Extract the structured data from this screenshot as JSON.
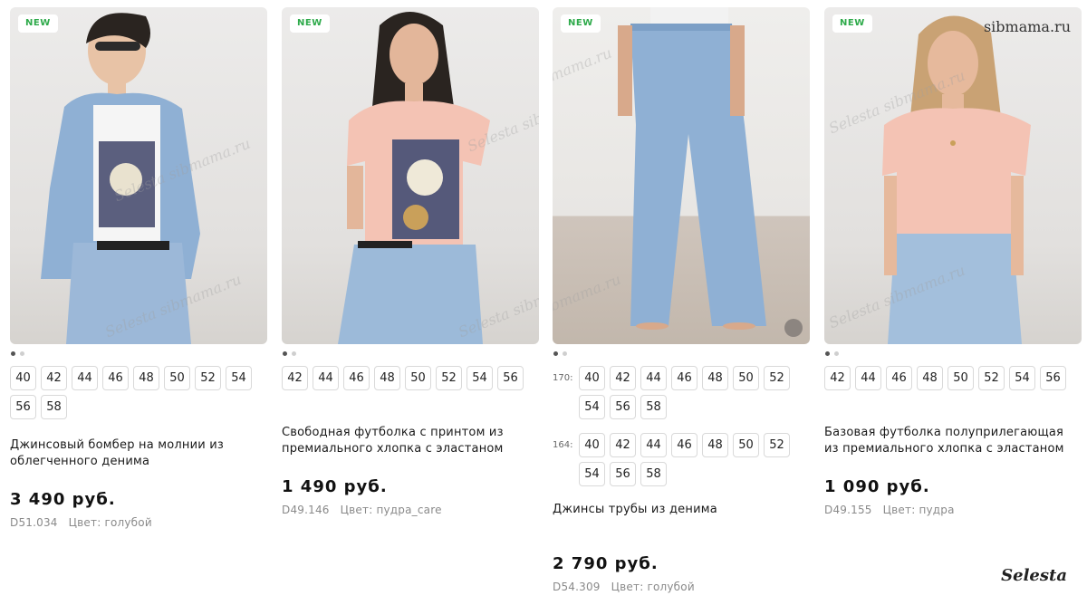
{
  "products": [
    {
      "badge": "NEW",
      "sizes": [
        "40",
        "42",
        "44",
        "46",
        "48",
        "50",
        "52",
        "54",
        "56",
        "58"
      ],
      "title_lines": [
        "Джинсовый бомбер на молнии из",
        "облегченного денима"
      ],
      "price": "3 490 руб.",
      "sku": "D51.034",
      "color": "Цвет: голубой"
    },
    {
      "badge": "NEW",
      "sizes": [
        "42",
        "44",
        "46",
        "48",
        "50",
        "52",
        "54",
        "56"
      ],
      "title_lines": [
        "Свободная футболка с принтом из",
        "премиального хлопка с эластаном"
      ],
      "price": "1 490 руб.",
      "sku": "D49.146",
      "color": "Цвет: пудра_care"
    },
    {
      "badge": "NEW",
      "size_groups": [
        {
          "height": "170:",
          "sizes": [
            "40",
            "42",
            "44",
            "46",
            "48",
            "50",
            "52",
            "54",
            "56",
            "58"
          ]
        },
        {
          "height": "164:",
          "sizes": [
            "40",
            "42",
            "44",
            "46",
            "48",
            "50",
            "52",
            "54",
            "56",
            "58"
          ]
        }
      ],
      "title_lines": [
        "Джинсы трубы из денима"
      ],
      "price": "2 790 руб.",
      "sku": "D54.309",
      "color": "Цвет: голубой"
    },
    {
      "badge": "NEW",
      "sizes": [
        "42",
        "44",
        "46",
        "48",
        "50",
        "52",
        "54",
        "56"
      ],
      "title_lines": [
        "Базовая футболка полуприлегающая",
        "из премиального хлопка с эластаном"
      ],
      "price": "1 090 руб.",
      "sku": "D49.155",
      "color": "Цвет: пудра"
    }
  ],
  "watermarks": {
    "top": "sibmama.ru",
    "bottom": "Selesta",
    "diagonal": "Selesta sibmama.ru"
  },
  "colors": {
    "badge_text": "#2eaa4a",
    "denim": "#8fb0d4",
    "pink_tee": "#f4c3b4"
  }
}
